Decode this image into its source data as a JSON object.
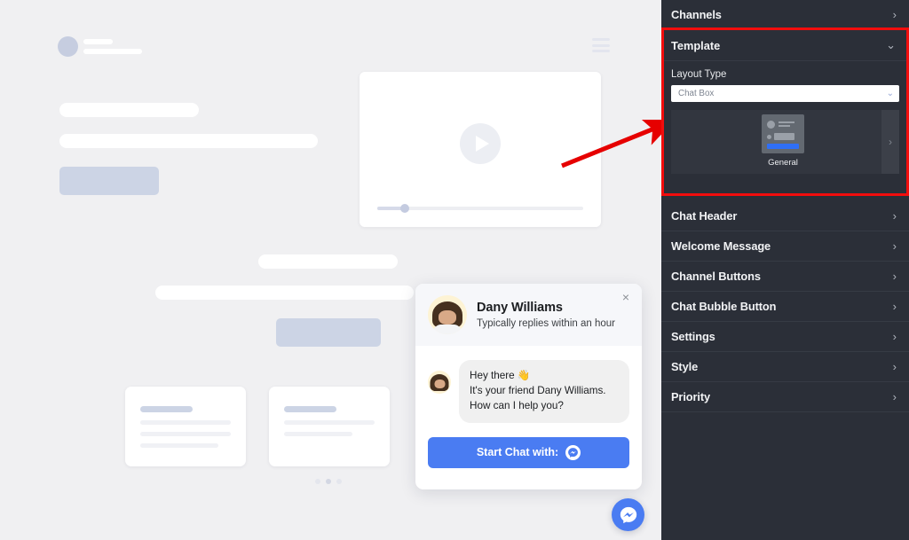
{
  "sidebar": {
    "top_item": {
      "label": "Channels",
      "chevron": "chevron-right"
    },
    "template_section": {
      "title": "Template",
      "chevron": "chevron-down",
      "layout_label": "Layout Type",
      "layout_value": "Chat Box",
      "layout_chevron": "chevron-down",
      "cards": [
        {
          "label": "General"
        }
      ],
      "next_chevron": "chevron-right"
    },
    "items": [
      {
        "label": "Chat Header",
        "chevron": "chevron-right"
      },
      {
        "label": "Welcome Message",
        "chevron": "chevron-right"
      },
      {
        "label": "Channel Buttons",
        "chevron": "chevron-right"
      },
      {
        "label": "Chat Bubble Button",
        "chevron": "chevron-right"
      },
      {
        "label": "Settings",
        "chevron": "chevron-right"
      },
      {
        "label": "Style",
        "chevron": "chevron-right"
      },
      {
        "label": "Priority",
        "chevron": "chevron-right"
      }
    ]
  },
  "chat_widget": {
    "agent_name": "Dany Williams",
    "agent_status": "Typically replies within an hour",
    "close_label": "×",
    "message_line1": "Hey there 👋",
    "message_line2": "It's your friend Dany Williams. How can I help you?",
    "start_button_label": "Start Chat with:",
    "start_button_icon": "messenger-icon"
  },
  "fab": {
    "icon": "messenger-icon"
  },
  "preview": {
    "menu_icon": "hamburger-icon",
    "play_icon": "play-icon",
    "carousel_dots": 3,
    "active_dot_index": 1
  },
  "annotation": {
    "arrow_color": "#e60000",
    "highlight_color": "#f20d0d"
  },
  "colors": {
    "sidebar_bg": "#2b2f38",
    "preview_bg": "#f0f0f2",
    "accent_blue": "#4a7cf2",
    "skeleton_blue": "#ccd4e5"
  }
}
